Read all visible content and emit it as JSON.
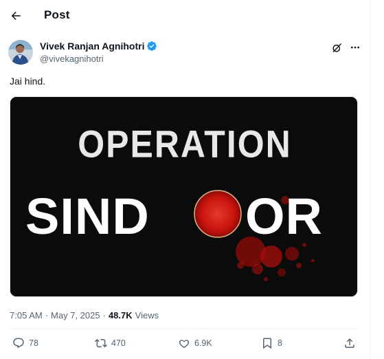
{
  "header": {
    "back_icon": "arrow-left-icon",
    "title": "Post"
  },
  "author": {
    "name": "Vivek Ranjan Agnihotri",
    "handle": "@vivekagnihotri",
    "verified_icon": "verified-badge-icon",
    "verified_color": "#1d9bf0"
  },
  "post": {
    "text": "Jai hind.",
    "image": {
      "line1": "OPERATION",
      "line2_left": "SIND",
      "line2_right": "OR"
    },
    "time": "7:05 AM",
    "date": "May 7, 2025",
    "views_count": "48.7K",
    "views_label": "Views"
  },
  "actions": {
    "replies": "78",
    "reposts": "470",
    "likes": "6.9K",
    "bookmarks": "8"
  },
  "icons": [
    "grok-icon",
    "more-icon",
    "reply-icon",
    "repost-icon",
    "like-icon",
    "bookmark-icon",
    "share-icon"
  ]
}
